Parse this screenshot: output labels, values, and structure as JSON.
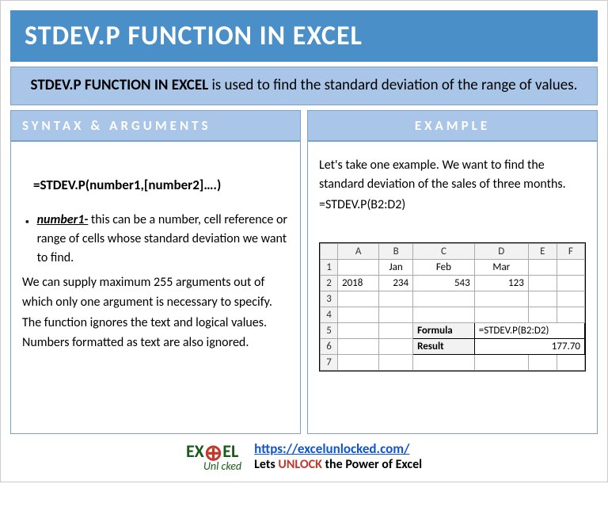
{
  "title": "STDEV.P FUNCTION IN EXCEL",
  "description": {
    "bold": "STDEV.P FUNCTION IN EXCEL",
    "rest": " is used to find the standard deviation of the range of values."
  },
  "syntax": {
    "header": "SYNTAX & ARGUMENTS",
    "formula": "=STDEV.P(number1,[number2]….)",
    "arg_name": "number1-",
    "arg_desc": " this can be a number, cell reference or range of cells whose standard deviation we want to find.",
    "note": "We can supply maximum 255 arguments out of which only one argument is necessary to specify. The function ignores the text and logical values. Numbers formatted as text are also ignored."
  },
  "example": {
    "header": "EXAMPLE",
    "intro": "Let's take one example. We want to find the standard deviation of the sales of three months.",
    "formula": "=STDEV.P(B2:D2)",
    "sheet": {
      "cols": [
        "A",
        "B",
        "C",
        "D",
        "E",
        "F"
      ],
      "rows": [
        "1",
        "2",
        "3",
        "4",
        "5",
        "6",
        "7"
      ],
      "months": [
        "Jan",
        "Feb",
        "Mar"
      ],
      "year": "2018",
      "values": [
        "234",
        "543",
        "123"
      ],
      "formula_label": "Formula",
      "formula_value": "=STDEV.P(B2:D2)",
      "result_label": "Result",
      "result_value": "177.70"
    }
  },
  "footer": {
    "logo_top_1": "EX",
    "logo_top_2": "EL",
    "logo_bottom": "Unl  cked",
    "url": "https://excelunlocked.com/",
    "tag_1": "Lets ",
    "tag_unlock": "UNLOCK",
    "tag_2": " the Power of Excel"
  }
}
